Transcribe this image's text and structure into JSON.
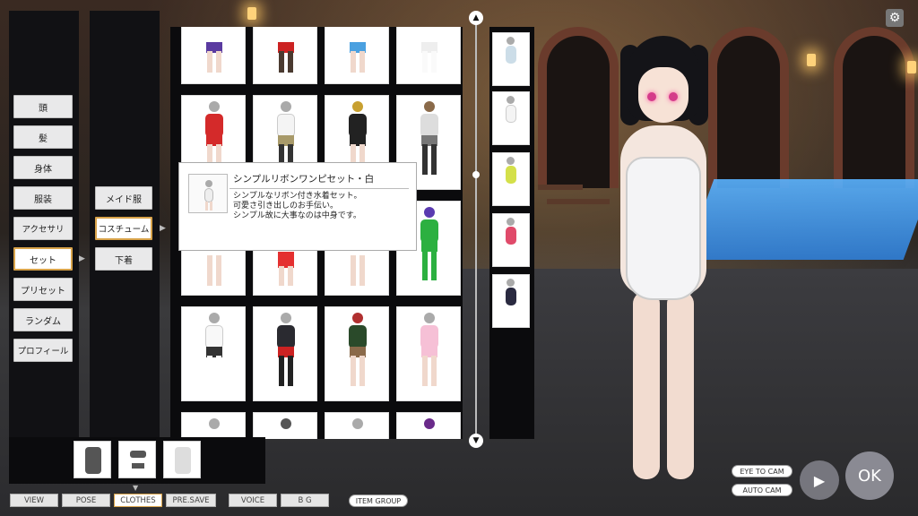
{
  "main_menu": [
    "頭",
    "髪",
    "身体",
    "服装",
    "アクセサリ",
    "セット",
    "プリセット",
    "ランダム",
    "プロフィール"
  ],
  "main_menu_selected": "セット",
  "sub_menu": [
    "メイド服",
    "コスチューム",
    "下着"
  ],
  "sub_menu_selected": "コスチューム",
  "tooltip": {
    "title": "シンプルリボンワンピセット・白",
    "line1": "シンプルなリボン付き水着セット。",
    "line2": "可愛さ引き出しのお手伝い。",
    "line3": "シンプル故に大事なのは中身です。"
  },
  "bottom_tabs": [
    "VIEW",
    "POSE",
    "CLOTHES",
    "PRE.SAVE",
    "VOICE",
    "B G"
  ],
  "bottom_tab_selected": "CLOTHES",
  "item_group": "ITEM GROUP",
  "camera": {
    "eye_to_cam": "EYE TO CAM",
    "auto_cam": "AUTO CAM"
  },
  "ok_label": "OK",
  "colors": {
    "accent": "#d8a34a",
    "panel": "#111114",
    "button": "#e9e9ea"
  }
}
